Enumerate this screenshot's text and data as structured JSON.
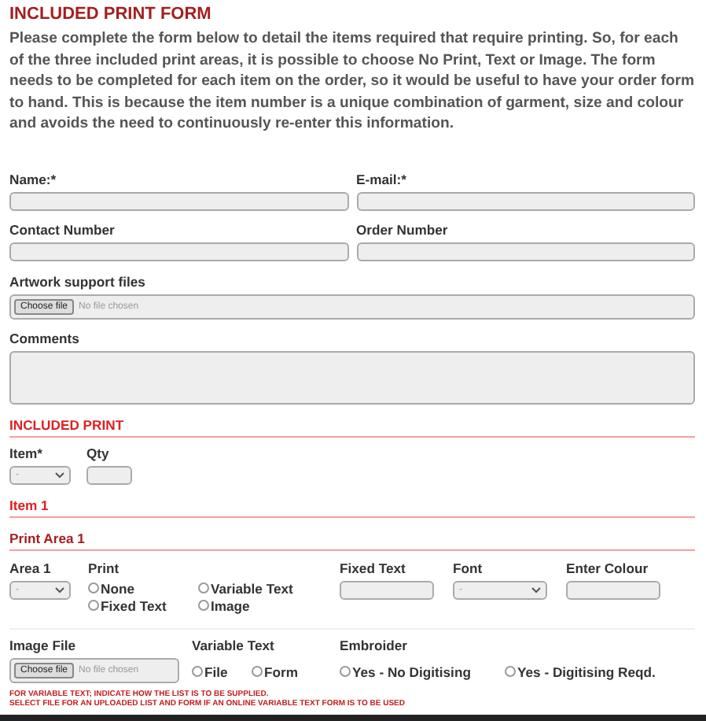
{
  "title": "INCLUDED PRINT FORM",
  "intro": "Please complete the form below to detail the items required that require printing.  So, for each of the three included print areas, it is possible to choose No Print, Text or Image.  The form needs to be completed for each item on the order, so it would be useful to have your order form to hand.  This is because the item number is a unique combination of garment, size and colour and avoids the need to continuously re-enter this information.",
  "contact_fields": [
    {
      "label": "Name:*"
    },
    {
      "label": "E-mail:*"
    },
    {
      "label": "Contact Number"
    },
    {
      "label": "Order Number"
    }
  ],
  "artwork": {
    "label": "Artwork support files",
    "button": "Choose file",
    "status": "No file chosen"
  },
  "comments": {
    "label": "Comments"
  },
  "included_print": {
    "heading": "INCLUDED PRINT",
    "item": {
      "label": "Item*",
      "value": "-"
    },
    "qty": {
      "label": "Qty"
    }
  },
  "item_heading": "Item 1",
  "print_area": {
    "heading": "Print Area 1",
    "area": {
      "label": "Area 1",
      "value": "-"
    },
    "print": {
      "label": "Print",
      "options": [
        {
          "label": "None",
          "selected": false
        },
        {
          "label": "Variable Text",
          "selected": false
        },
        {
          "label": "Fixed Text",
          "selected": false
        },
        {
          "label": "Image",
          "selected": false
        }
      ]
    },
    "fixed_text": {
      "label": "Fixed Text"
    },
    "font": {
      "label": "Font",
      "value": "-"
    },
    "colour": {
      "label": "Enter Colour"
    },
    "image_file": {
      "label": "Image File",
      "button": "Choose file",
      "status": "No file chosen"
    },
    "variable_text": {
      "label": "Variable Text",
      "options": [
        {
          "label": "File",
          "selected": false
        },
        {
          "label": "Form",
          "selected": false
        }
      ]
    },
    "embroider": {
      "label": "Embroider",
      "options": [
        {
          "label": "Yes - No Digitising",
          "selected": false
        },
        {
          "label": "Yes - Digitising Reqd.",
          "selected": false
        }
      ]
    },
    "notes": [
      "FOR VARIABLE TEXT; INDICATE HOW THE LIST IS TO BE SUPPLIED.",
      "SELECT FILE FOR AN UPLOADED LIST AND FORM IF AN ONLINE VARIABLE TEXT FORM IS TO BE USED"
    ]
  }
}
